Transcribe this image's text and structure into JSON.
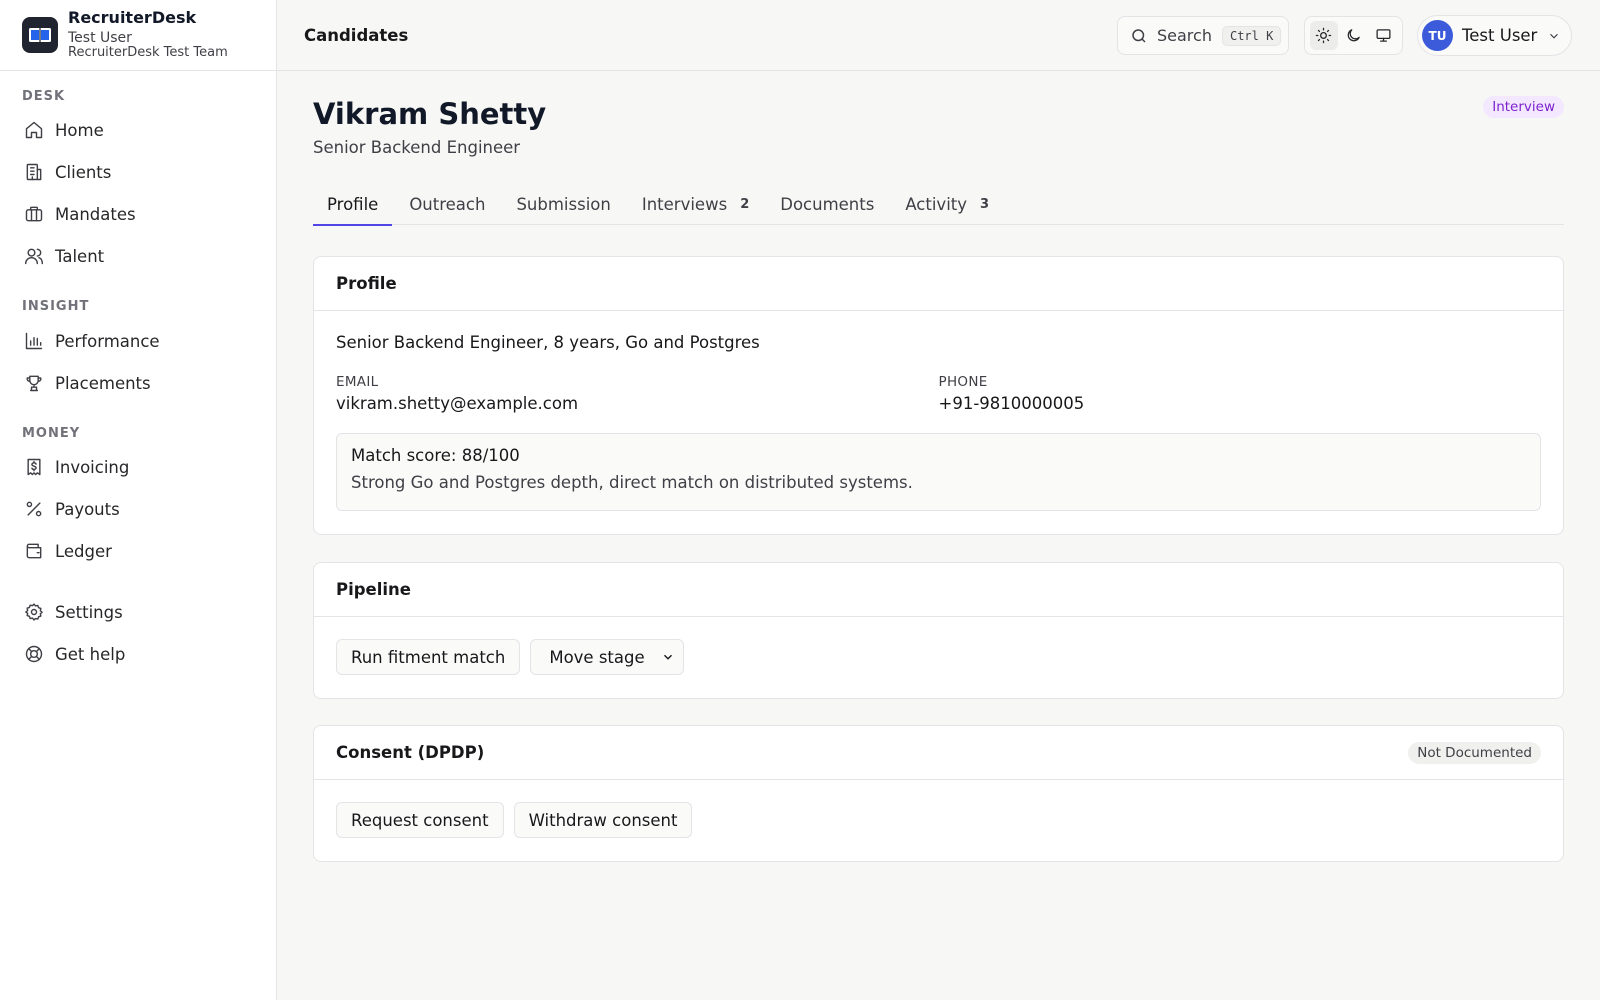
{
  "brand": {
    "name": "RecruiterDesk",
    "user": "Test User",
    "team": "RecruiterDesk Test Team"
  },
  "sidebar": {
    "sections": [
      {
        "title": "DESK",
        "items": [
          {
            "label": "Home",
            "icon": "home-icon"
          },
          {
            "label": "Clients",
            "icon": "building-icon"
          },
          {
            "label": "Mandates",
            "icon": "briefcase-icon"
          },
          {
            "label": "Talent",
            "icon": "users-icon"
          }
        ]
      },
      {
        "title": "INSIGHT",
        "items": [
          {
            "label": "Performance",
            "icon": "bar-chart-icon"
          },
          {
            "label": "Placements",
            "icon": "trophy-icon"
          }
        ]
      },
      {
        "title": "MONEY",
        "items": [
          {
            "label": "Invoicing",
            "icon": "receipt-icon"
          },
          {
            "label": "Payouts",
            "icon": "percent-icon"
          },
          {
            "label": "Ledger",
            "icon": "wallet-icon"
          }
        ]
      }
    ],
    "footer_items": [
      {
        "label": "Settings",
        "icon": "gear-icon"
      },
      {
        "label": "Get help",
        "icon": "lifebuoy-icon"
      }
    ]
  },
  "topbar": {
    "title": "Candidates",
    "search_label": "Search",
    "search_shortcut": "Ctrl K",
    "user_initials": "TU",
    "user_name": "Test User"
  },
  "candidate": {
    "name": "Vikram Shetty",
    "title": "Senior Backend Engineer",
    "stage": "Interview"
  },
  "tabs": [
    {
      "label": "Profile",
      "count": "",
      "active": true
    },
    {
      "label": "Outreach",
      "count": ""
    },
    {
      "label": "Submission",
      "count": ""
    },
    {
      "label": "Interviews",
      "count": "2"
    },
    {
      "label": "Documents",
      "count": ""
    },
    {
      "label": "Activity",
      "count": "3"
    }
  ],
  "profile": {
    "heading": "Profile",
    "summary": "Senior Backend Engineer, 8 years, Go and Postgres",
    "email_label": "EMAIL",
    "email": "vikram.shetty@example.com",
    "phone_label": "PHONE",
    "phone": "+91-9810000005",
    "match_score": "Match score: 88/100",
    "match_note": "Strong Go and Postgres depth, direct match on distributed systems."
  },
  "pipeline": {
    "heading": "Pipeline",
    "run_fitment_label": "Run fitment match",
    "move_stage_label": "Move stage"
  },
  "consent": {
    "heading": "Consent (DPDP)",
    "status": "Not Documented",
    "request_label": "Request consent",
    "withdraw_label": "Withdraw consent"
  },
  "colors": {
    "accent": "#4f46e5",
    "avatar": "#3b5bdb",
    "stage_badge_bg": "#f3e8ff",
    "stage_badge_text": "#7e22ce"
  }
}
